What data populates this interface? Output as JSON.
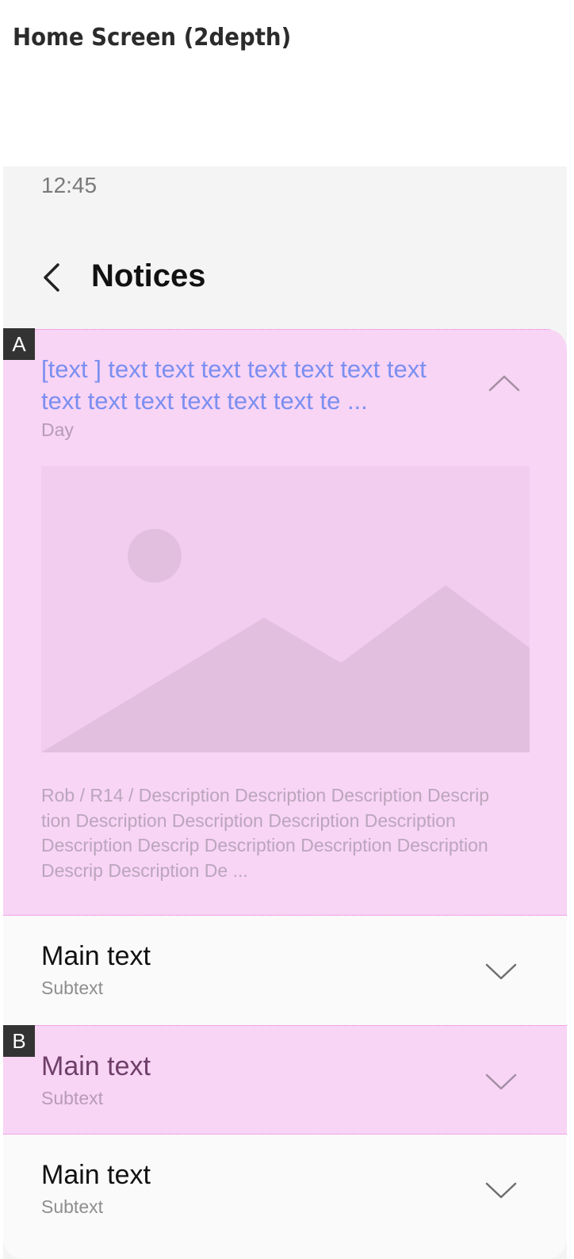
{
  "page_title": "Home Screen (2depth)",
  "status_bar": {
    "time": "12:45"
  },
  "header": {
    "title": "Notices"
  },
  "tags": {
    "a": "A",
    "b": "B"
  },
  "notice": {
    "title": "[text ] text text text text text text text text text text text text text te ...",
    "day": "Day",
    "description": "Rob / R14 / Description Description Description Descrip tion Description Description Description Description Description Descrip Description Description Description Descrip Description De ..."
  },
  "rows": [
    {
      "main": "Main text",
      "sub": "Subtext"
    },
    {
      "main": "Main text",
      "sub": "Subtext"
    },
    {
      "main": "Main text",
      "sub": "Subtext"
    }
  ],
  "colors": {
    "highlight": "#f8d4f5",
    "title_accent": "#7b8ff0",
    "placeholder_bg": "#f2cdef",
    "placeholder_shape": "#e3bfdf"
  }
}
